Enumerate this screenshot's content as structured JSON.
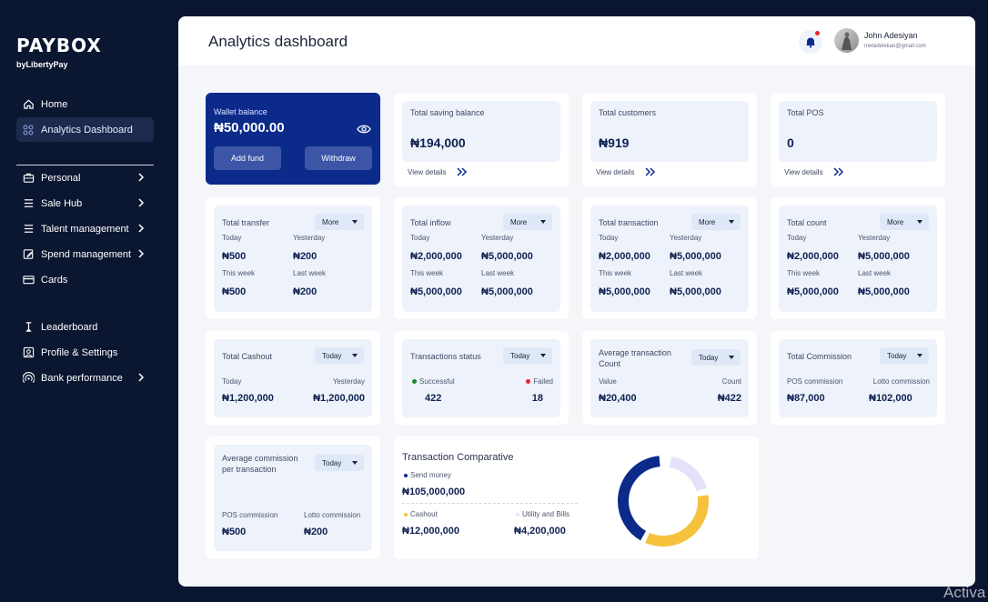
{
  "brand": {
    "name": "PAYBOX",
    "sub": "byLibertyPay"
  },
  "sidebar": {
    "top_items": [
      {
        "label": "Home",
        "icon": "home-icon"
      },
      {
        "label": "Analytics Dashboard",
        "icon": "grid-icon"
      }
    ],
    "items": [
      {
        "label": "Personal",
        "icon": "briefcase-icon"
      },
      {
        "label": "Sale Hub",
        "icon": "list-icon"
      },
      {
        "label": "Talent management",
        "icon": "list-icon"
      },
      {
        "label": "Spend management",
        "icon": "edit-icon"
      },
      {
        "label": "Cards",
        "icon": "card-icon"
      }
    ],
    "bottom_items": [
      {
        "label": "Leaderboard",
        "icon": "trophy-icon"
      },
      {
        "label": "Profile & Settings",
        "icon": "profile-icon"
      },
      {
        "label": "Bank performance",
        "icon": "signal-icon"
      }
    ]
  },
  "header": {
    "title": "Analytics dashboard",
    "user_name": "John Adesiyan",
    "user_email": "metadelekan@gmail.com"
  },
  "wallet": {
    "label": "Wallet balance",
    "value": "₦50,000.00",
    "add_fund": "Add fund",
    "withdraw": "Withdraw"
  },
  "summary": [
    {
      "label": "Total saving balance",
      "value": "₦194,000",
      "link": "View details"
    },
    {
      "label": "Total customers",
      "value": "₦919",
      "link": "View details"
    },
    {
      "label": "Total POS",
      "value": "0",
      "link": "View details"
    }
  ],
  "stats": [
    {
      "title": "Total transfer",
      "dropdown": "More",
      "today_label": "Today",
      "yesterday_label": "Yesterday",
      "today": "₦500",
      "yesterday": "₦200",
      "week_label": "This week",
      "last_week_label": "Last week",
      "week": "₦500",
      "last_week": "₦200"
    },
    {
      "title": "Total inflow",
      "dropdown": "More",
      "today_label": "Today",
      "yesterday_label": "Yesterday",
      "today": "₦2,000,000",
      "yesterday": "₦5,000,000",
      "week_label": "This week",
      "last_week_label": "Last week",
      "week": "₦5,000,000",
      "last_week": "₦5,000,000"
    },
    {
      "title": "Total transaction",
      "dropdown": "More",
      "today_label": "Today",
      "yesterday_label": "Yesterday",
      "today": "₦2,000,000",
      "yesterday": "₦5,000,000",
      "week_label": "This week",
      "last_week_label": "Last week",
      "week": "₦5,000,000",
      "last_week": "₦5,000,000"
    },
    {
      "title": "Total count",
      "dropdown": "More",
      "today_label": "Today",
      "yesterday_label": "Yesterday",
      "today": "₦2,000,000",
      "yesterday": "₦5,000,000",
      "week_label": "This week",
      "last_week_label": "Last week",
      "week": "₦5,000,000",
      "last_week": "₦5,000,000"
    }
  ],
  "row3": [
    {
      "title": "Total Cashout",
      "dropdown": "Today",
      "left_label": "Today",
      "right_label": "Yesterday",
      "left": "₦1,200,000",
      "right": "₦1,200,000"
    },
    {
      "title": "Transactions status",
      "dropdown": "Today",
      "left_label": "Successful",
      "right_label": "Failed",
      "left": "422",
      "right": "18"
    },
    {
      "title": "Average transaction Count",
      "dropdown": "Today",
      "left_label": "Value",
      "right_label": "Count",
      "left": "₦20,400",
      "right": "₦422"
    },
    {
      "title": "Total Commission",
      "dropdown": "Today",
      "left_label": "POS commission",
      "right_label": "Lotto commission",
      "left": "₦87,000",
      "right": "₦102,000"
    }
  ],
  "avg_commission": {
    "title": "Average commission per transaction",
    "dropdown": "Today",
    "left_label": "POS commission",
    "right_label": "Lotto commission",
    "left": "₦500",
    "right": "₦200"
  },
  "comparative": {
    "title": "Transaction Comparative",
    "send_label": "Send money",
    "send_value": "₦105,000,000",
    "cashout_label": "Cashout",
    "cashout_value": "₦12,000,000",
    "bills_label": "Utility and Bills",
    "bills_value": "₦4,200,000",
    "colors": {
      "send": "#0b2a8a",
      "cashout": "#f6c23e",
      "bills": "#e5e1fb"
    }
  },
  "watermark": "Activa",
  "colors": {
    "accent": "#0b2a8a",
    "sidebar": "#0b1631",
    "notification": "#e5252b"
  }
}
